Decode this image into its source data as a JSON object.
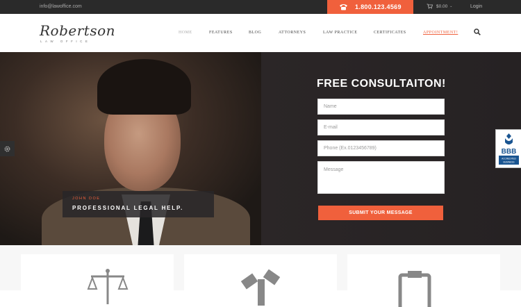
{
  "topbar": {
    "email": "info@lawoffice.com",
    "phone": "1.800.123.4569",
    "cart": "$0.00",
    "login": "Login"
  },
  "header": {
    "logo_main": "Robertson",
    "logo_sub": "LAW OFFICE",
    "nav": [
      "HOME",
      "FEATURES",
      "BLOG",
      "ATTORNEYS",
      "LAW PRACTICE",
      "CERTIFICATES",
      "APPOINTMENT!"
    ]
  },
  "hero": {
    "caption_small": "JOHN DOE",
    "caption_big": "PROFESSIONAL LEGAL HELP."
  },
  "form": {
    "title": "FREE CONSULTAITON!",
    "name_placeholder": "Name",
    "email_placeholder": "E-mail",
    "phone_placeholder": "Phone (Ex.0123456789)",
    "message_placeholder": "Message",
    "submit": "SUBMIT YOUR MESSAGE"
  },
  "badge": {
    "logo_text": "BBB",
    "sub_text": "ACCREDITED BUSINESS"
  },
  "colors": {
    "accent": "#f0603c",
    "dark": "#262324"
  }
}
